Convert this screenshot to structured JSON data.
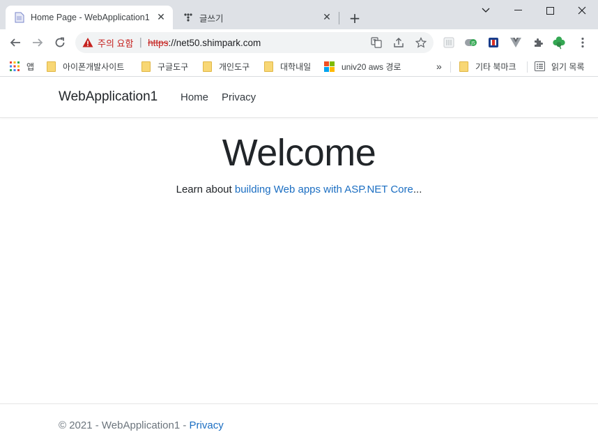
{
  "window": {
    "tabs": [
      {
        "title": "Home Page - WebApplication1",
        "close": "✕"
      },
      {
        "title": "글쓰기",
        "close": "✕"
      }
    ],
    "new_tab": "+",
    "controls": {
      "minimize": "—",
      "maximize": "☐",
      "close": "✕",
      "tab_search": "⌄"
    }
  },
  "toolbar": {
    "warning_text": "주의 요함",
    "separator": "|",
    "url_scheme": "https",
    "url_rest": "://net50.shimpark.com"
  },
  "bookmarks": {
    "apps_label": "앱",
    "items": [
      "아이폰개발사이트",
      "구글도구",
      "개인도구",
      "대학내일",
      "univ20 aws 경로"
    ],
    "overflow": "»",
    "other": "기타 북마크",
    "reading_list": "읽기 목록"
  },
  "site": {
    "brand": "WebApplication1",
    "nav": [
      "Home",
      "Privacy"
    ],
    "heading": "Welcome",
    "learn_prefix": "Learn about ",
    "learn_link": "building Web apps with ASP.NET Core",
    "learn_suffix": "...",
    "footer_prefix": "© 2021 - WebApplication1 - ",
    "footer_link": "Privacy"
  },
  "colors": {
    "tabstrip": "#dee1e6",
    "warning": "#c5221f",
    "link": "#1b6ec2"
  }
}
